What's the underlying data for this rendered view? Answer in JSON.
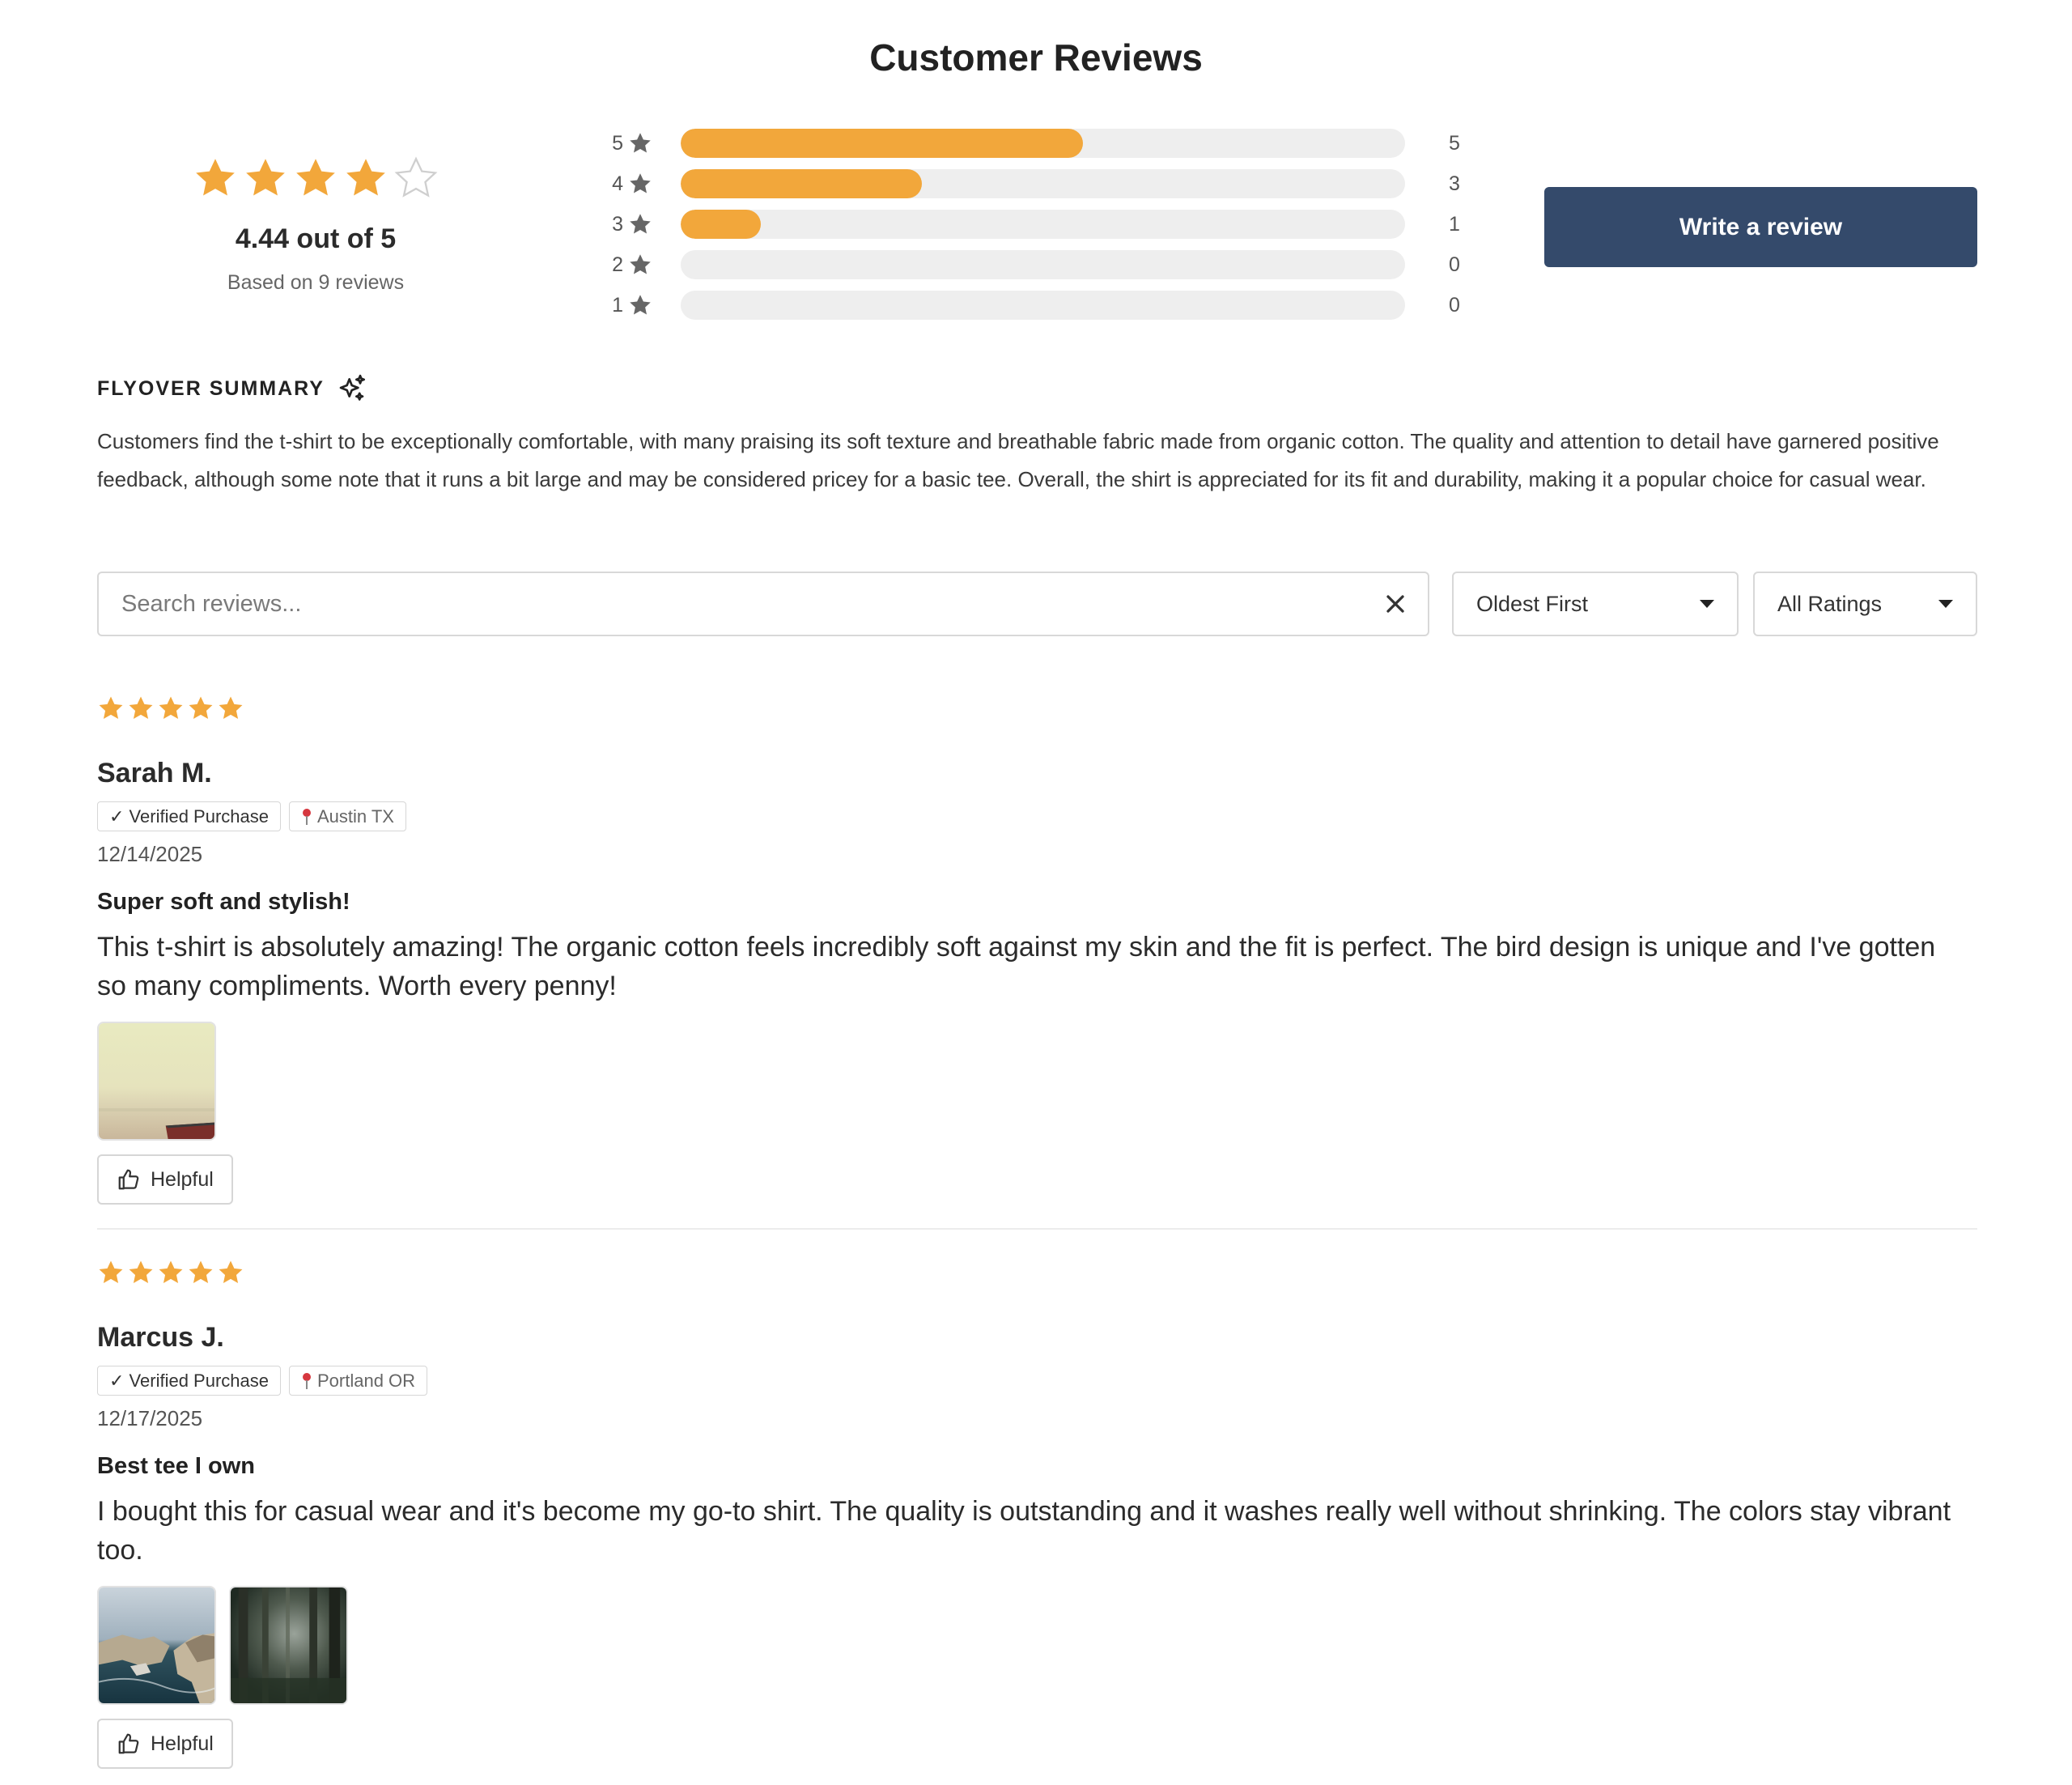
{
  "header": {
    "title": "Customer Reviews"
  },
  "summary": {
    "average": 4.44,
    "average_text": "4.44 out of 5",
    "based_on": "Based on 9 reviews",
    "star_color": "#f2a73b",
    "histogram": [
      {
        "label": "5",
        "count": "5",
        "fraction": 0.5556
      },
      {
        "label": "4",
        "count": "3",
        "fraction": 0.3333
      },
      {
        "label": "3",
        "count": "1",
        "fraction": 0.1111
      },
      {
        "label": "2",
        "count": "0",
        "fraction": 0
      },
      {
        "label": "1",
        "count": "0",
        "fraction": 0
      }
    ],
    "write_review_label": "Write a review",
    "button_color": "#344a6b"
  },
  "flyover": {
    "title": "FLYOVER SUMMARY",
    "icon": "sparkles-icon",
    "text": "Customers find the t-shirt to be exceptionally comfortable, with many praising its soft texture and breathable fabric made from organic cotton. The quality and attention to detail have garnered positive feedback, although some note that it runs a bit large and may be considered pricey for a basic tee. Overall, the shirt is appreciated for its fit and durability, making it a popular choice for casual wear."
  },
  "controls": {
    "search_placeholder": "Search reviews...",
    "search_value": "",
    "sort_selected": "Oldest First",
    "rating_filter_selected": "All Ratings"
  },
  "reviews": [
    {
      "rating": 5,
      "name": "Sarah M.",
      "verified": "✓ Verified Purchase",
      "location": "Austin TX",
      "date": "12/14/2025",
      "title": "Super soft and stylish!",
      "body": "This t-shirt is absolutely amazing! The organic cotton feels incredibly soft against my skin and the fit is perfect. The bird design is unique and I've gotten so many compliments. Worth every penny!",
      "photos": [
        "beach-haze-photo"
      ],
      "helpful_label": "Helpful"
    },
    {
      "rating": 5,
      "name": "Marcus J.",
      "verified": "✓ Verified Purchase",
      "location": "Portland OR",
      "date": "12/17/2025",
      "title": "Best tee I own",
      "body": "I bought this for casual wear and it's become my go-to shirt. The quality is outstanding and it washes really well without shrinking. The colors stay vibrant too.",
      "photos": [
        "coastal-cliffs-photo",
        "forest-photo"
      ],
      "helpful_label": "Helpful"
    }
  ]
}
